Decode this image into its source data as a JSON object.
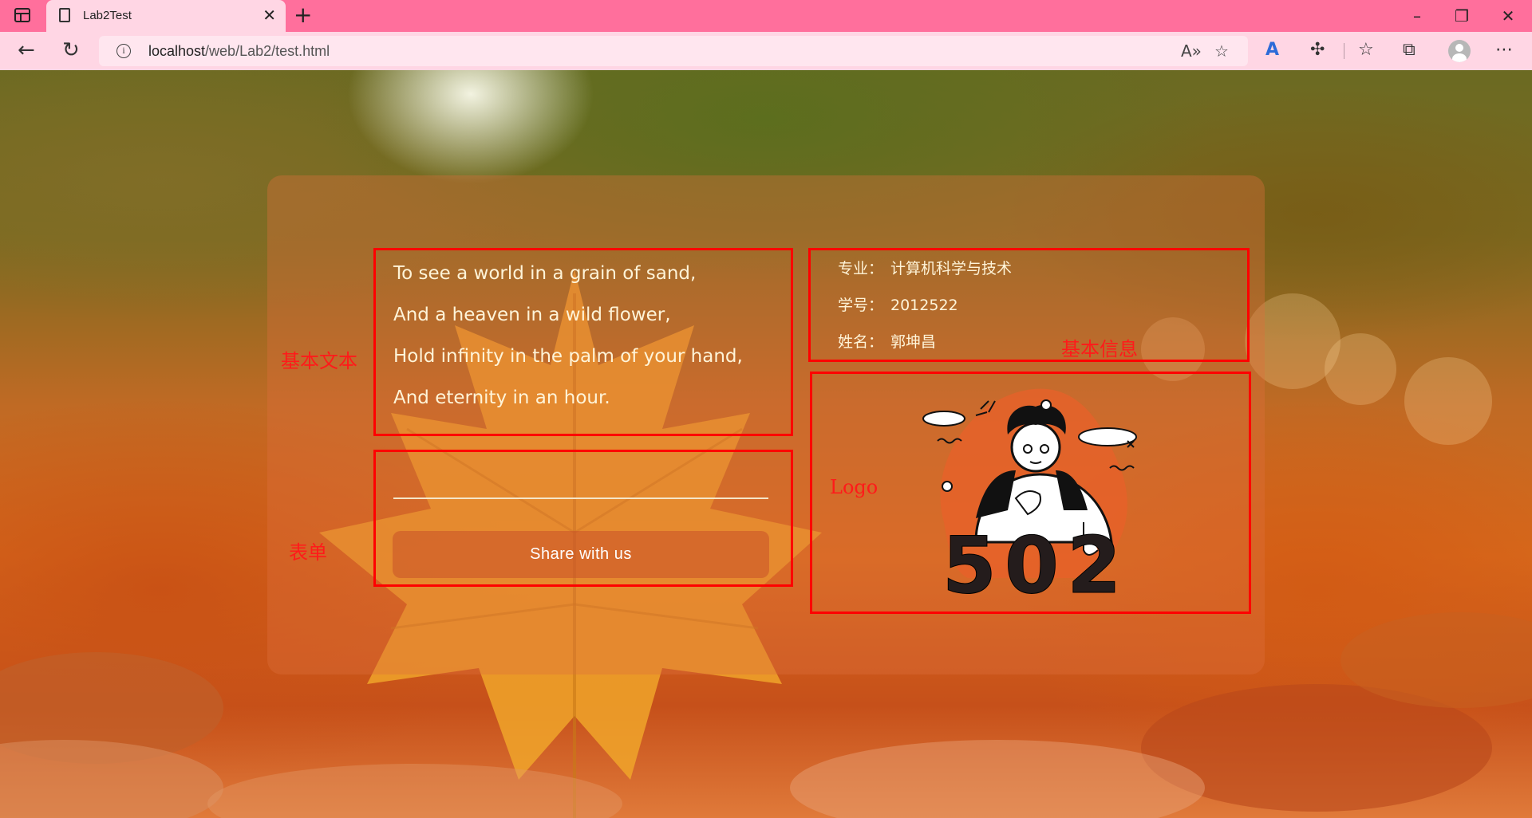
{
  "browser": {
    "tab_title": "Lab2Test",
    "url_host": "localhost",
    "url_path": "/web/Lab2/test.html"
  },
  "annotations": {
    "basic_text": "基本文本",
    "form": "表单",
    "basic_info": "基本信息",
    "logo": "Logo"
  },
  "poem": {
    "lines": [
      "To see a world in a grain of sand,",
      "And a heaven in a wild flower,",
      "Hold infinity in the palm of your hand,",
      "And eternity in an hour."
    ]
  },
  "info": {
    "rows": [
      {
        "key": "专业：",
        "value": "计算机科学与技术"
      },
      {
        "key": "学号：",
        "value": "2012522"
      },
      {
        "key": "姓名：",
        "value": "郭坤昌"
      }
    ]
  },
  "form": {
    "input_value": "",
    "button_label": "Share with us"
  },
  "logo": {
    "number_text": "502"
  },
  "colors": {
    "chrome_pink": "#ff6f9c",
    "toolbar_pink": "#ffd6e4",
    "annotation_red": "#ff0000",
    "text_cream": "#fff4d8"
  }
}
